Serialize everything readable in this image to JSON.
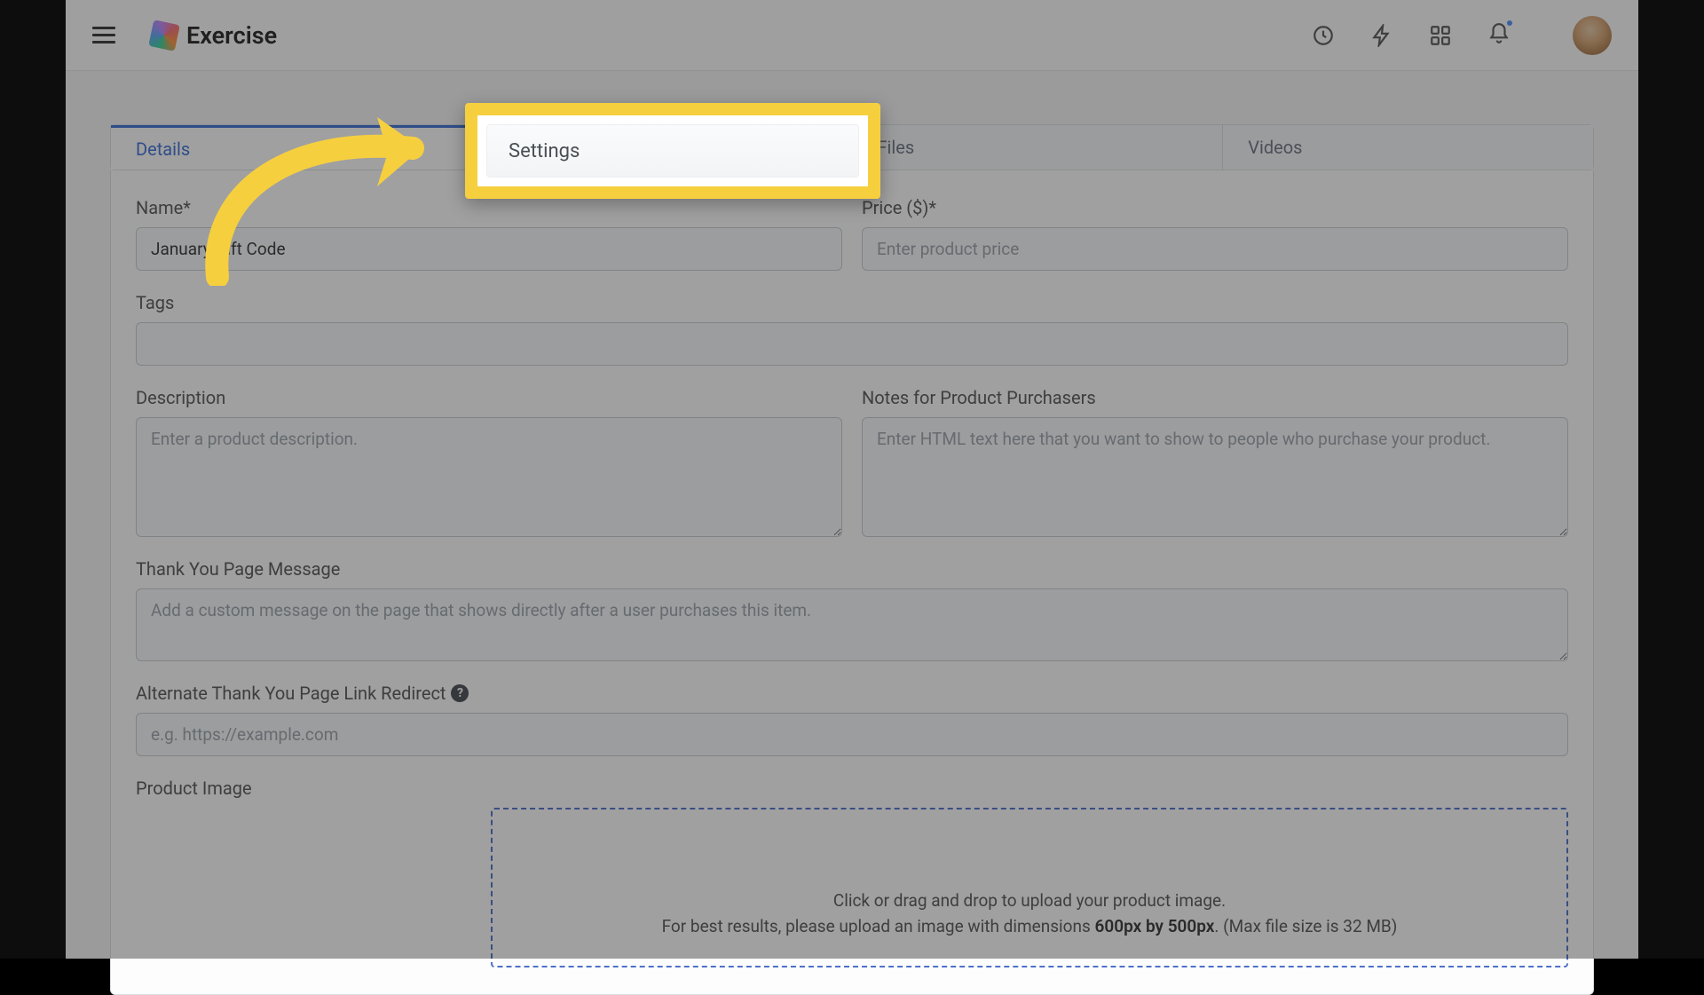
{
  "brand": {
    "name": "Exercise"
  },
  "tabs": {
    "items": [
      {
        "label": "Details"
      },
      {
        "label": "Settings"
      },
      {
        "label": "Files"
      },
      {
        "label": "Videos"
      }
    ]
  },
  "highlight": {
    "label": "Settings"
  },
  "form": {
    "name": {
      "label": "Name*",
      "value": "January Gift Code"
    },
    "price": {
      "label": "Price ($)*",
      "placeholder": "Enter product price"
    },
    "tags": {
      "label": "Tags"
    },
    "description": {
      "label": "Description",
      "placeholder": "Enter a product description."
    },
    "notes": {
      "label": "Notes for Product Purchasers",
      "placeholder": "Enter HTML text here that you want to show to people who purchase your product."
    },
    "thankyou": {
      "label": "Thank You Page Message",
      "placeholder": "Add a custom message on the page that shows directly after a user purchases this item."
    },
    "redirect": {
      "label": "Alternate Thank You Page Link Redirect",
      "placeholder": "e.g. https://example.com"
    },
    "image": {
      "label": "Product Image",
      "line1": "Click or drag and drop to upload your product image.",
      "line2a": "For best results, please upload an image with dimensions ",
      "line2b": "600px by 500px",
      "line2c": ". (Max file size is 32 MB)"
    }
  }
}
